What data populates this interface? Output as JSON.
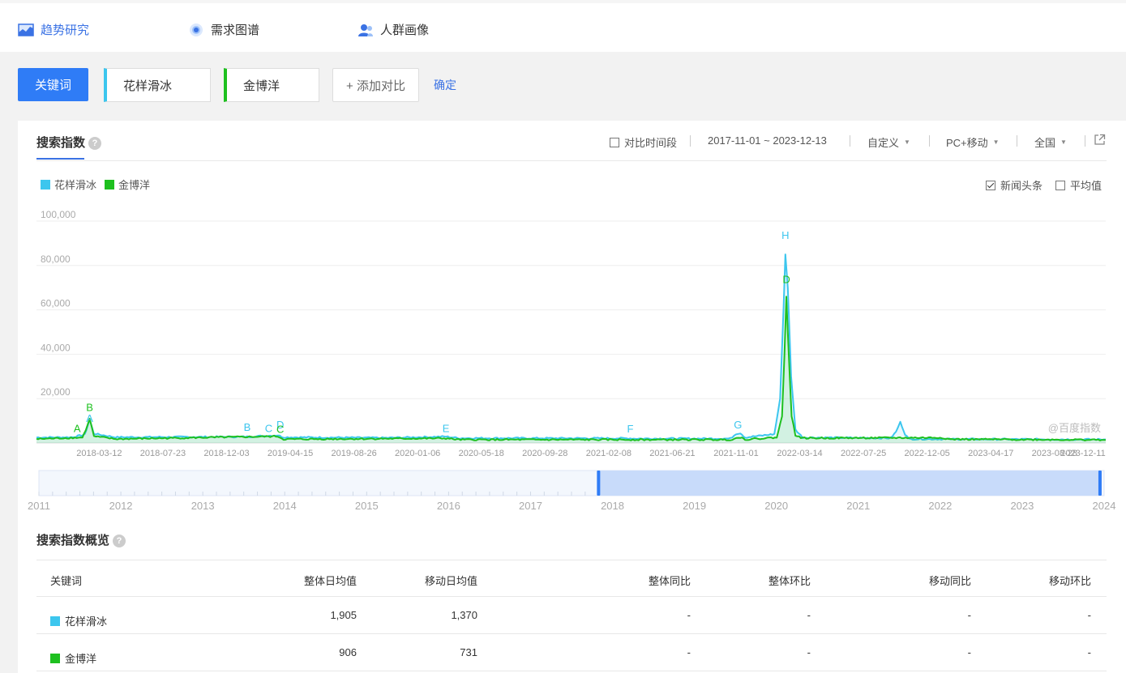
{
  "nav": {
    "items": [
      {
        "label": "趋势研究",
        "icon": "trend-chart-icon",
        "active": true
      },
      {
        "label": "需求图谱",
        "icon": "target-dot-icon",
        "active": false
      },
      {
        "label": "人群画像",
        "icon": "user-group-icon",
        "active": false
      }
    ]
  },
  "keywords": {
    "button_label": "关键词",
    "terms": [
      "花样滑冰",
      "金博洋"
    ],
    "add_label": "+ 添加对比",
    "confirm_label": "确定"
  },
  "panel": {
    "title": "搜索指数",
    "compare_period_label": "对比时间段",
    "date_range": "2017-11-01 ~ 2023-12-13",
    "custom_label": "自定义",
    "device_label": "PC+移动",
    "region_label": "全国",
    "news_label": "新闻头条",
    "avg_label": "平均值"
  },
  "colors": {
    "accent": "#2f7cf6",
    "series1": "#3cc6ee",
    "series2": "#1ec01f"
  },
  "chart_data": {
    "type": "line",
    "series": [
      {
        "name": "花样滑冰",
        "color": "#3cc6ee"
      },
      {
        "name": "金博洋",
        "color": "#1ec01f"
      }
    ],
    "y_ticks": [
      "100,000",
      "80,000",
      "60,000",
      "40,000",
      "20,000"
    ],
    "ylim": [
      0,
      100000
    ],
    "x_tick_labels": [
      "2018-03-12",
      "2018-07-23",
      "2018-12-03",
      "2019-04-15",
      "2019-08-26",
      "2020-01-06",
      "2020-05-18",
      "2020-09-28",
      "2021-02-08",
      "2021-06-21",
      "2021-11-01",
      "2022-03-14",
      "2022-07-25",
      "2022-12-05",
      "2023-04-17",
      "2023-08-28",
      "2023-12-11"
    ],
    "x_range": [
      "2017-11-01",
      "2023-12-13"
    ],
    "data_points": {
      "花样滑冰": [
        [
          "2017-11-01",
          2500
        ],
        [
          "2018-01-15",
          2600
        ],
        [
          "2018-02-10",
          3800
        ],
        [
          "2018-02-20",
          10500
        ],
        [
          "2018-03-01",
          4200
        ],
        [
          "2018-04-15",
          2600
        ],
        [
          "2019-01-15",
          2800
        ],
        [
          "2019-03-20",
          3500
        ],
        [
          "2019-04-01",
          2600
        ],
        [
          "2019-11-01",
          2300
        ],
        [
          "2020-03-05",
          2900
        ],
        [
          "2020-04-01",
          2200
        ],
        [
          "2021-03-25",
          2100
        ],
        [
          "2021-04-01",
          2000
        ],
        [
          "2021-10-20",
          2000
        ],
        [
          "2021-11-01",
          4200
        ],
        [
          "2021-11-10",
          4500
        ],
        [
          "2021-11-20",
          2500
        ],
        [
          "2022-01-20",
          4000
        ],
        [
          "2022-02-01",
          20000
        ],
        [
          "2022-02-08",
          60000
        ],
        [
          "2022-02-12",
          85000
        ],
        [
          "2022-02-17",
          70000
        ],
        [
          "2022-02-24",
          30000
        ],
        [
          "2022-03-05",
          6000
        ],
        [
          "2022-03-20",
          2500
        ],
        [
          "2022-09-20",
          2200
        ],
        [
          "2022-10-01",
          5000
        ],
        [
          "2022-10-10",
          9500
        ],
        [
          "2022-10-20",
          4000
        ],
        [
          "2022-10-28",
          1800
        ],
        [
          "2023-12-13",
          1600
        ]
      ],
      "金博洋": [
        [
          "2017-11-01",
          1800
        ],
        [
          "2018-02-05",
          2500
        ],
        [
          "2018-02-15",
          7500
        ],
        [
          "2018-02-20",
          11000
        ],
        [
          "2018-03-01",
          3000
        ],
        [
          "2018-04-15",
          1800
        ],
        [
          "2019-03-20",
          3000
        ],
        [
          "2019-04-01",
          1700
        ],
        [
          "2020-03-05",
          2100
        ],
        [
          "2020-04-01",
          1500
        ],
        [
          "2021-10-20",
          1500
        ],
        [
          "2021-11-10",
          2600
        ],
        [
          "2021-11-20",
          1600
        ],
        [
          "2022-01-25",
          2500
        ],
        [
          "2022-02-05",
          12000
        ],
        [
          "2022-02-10",
          40000
        ],
        [
          "2022-02-14",
          66000
        ],
        [
          "2022-02-18",
          45000
        ],
        [
          "2022-02-25",
          12000
        ],
        [
          "2022-03-05",
          3500
        ],
        [
          "2022-03-20",
          2200
        ],
        [
          "2023-01-05",
          2400
        ],
        [
          "2023-01-20",
          1700
        ],
        [
          "2023-12-13",
          1400
        ]
      ]
    },
    "annotations": [
      {
        "label": "A",
        "series": "金博洋",
        "date": "2018-01-25",
        "value": 5000
      },
      {
        "label": "B",
        "series": "金博洋",
        "date": "2018-02-20",
        "value": 14500
      },
      {
        "label": "A",
        "series": "花样滑冰",
        "date": "2018-02-20",
        "value": 9500
      },
      {
        "label": "B",
        "series": "花样滑冰",
        "date": "2019-01-15",
        "value": 5500
      },
      {
        "label": "C",
        "series": "花样滑冰",
        "date": "2019-03-01",
        "value": 5000
      },
      {
        "label": "D",
        "series": "花样滑冰",
        "date": "2019-03-25",
        "value": 6500
      },
      {
        "label": "C",
        "series": "金博洋",
        "date": "2019-03-25",
        "value": 4500
      },
      {
        "label": "E",
        "series": "花样滑冰",
        "date": "2020-03-05",
        "value": 5000
      },
      {
        "label": "F",
        "series": "花样滑冰",
        "date": "2021-03-25",
        "value": 4800
      },
      {
        "label": "G",
        "series": "花样滑冰",
        "date": "2021-11-05",
        "value": 6500
      },
      {
        "label": "H",
        "series": "花样滑冰",
        "date": "2022-02-12",
        "value": 92000
      },
      {
        "label": "D",
        "series": "金博洋",
        "date": "2022-02-14",
        "value": 72000
      }
    ],
    "watermark": "@百度指数"
  },
  "slider": {
    "year_labels": [
      "2011",
      "2012",
      "2013",
      "2014",
      "2015",
      "2016",
      "2017",
      "2018",
      "2019",
      "2020",
      "2021",
      "2022",
      "2023",
      "2024"
    ],
    "range_start_year": 2017.83,
    "range_end_year": 2023.95
  },
  "summary": {
    "title": "搜索指数概览",
    "headers": [
      "关键词",
      "整体日均值",
      "移动日均值",
      "整体同比",
      "整体环比",
      "移动同比",
      "移动环比"
    ],
    "rows": [
      {
        "keyword": "花样滑冰",
        "overall_avg": "1,905",
        "mobile_avg": "1,370",
        "overall_yoy": "-",
        "overall_mom": "-",
        "mobile_yoy": "-",
        "mobile_mom": "-"
      },
      {
        "keyword": "金博洋",
        "overall_avg": "906",
        "mobile_avg": "731",
        "overall_yoy": "-",
        "overall_mom": "-",
        "mobile_yoy": "-",
        "mobile_mom": "-"
      }
    ]
  }
}
